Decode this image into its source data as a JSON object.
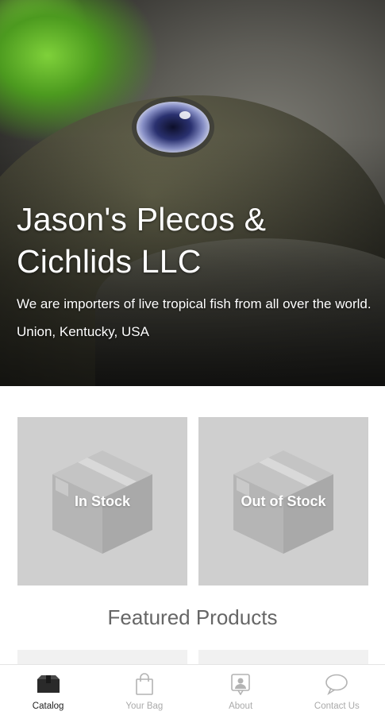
{
  "hero": {
    "title": "Jason's Plecos & Cichlids LLC",
    "tagline": "We are importers of live tropical fish from all over the world.",
    "location": "Union, Kentucky, USA"
  },
  "categories": [
    {
      "label": "In Stock",
      "icon": "box-icon"
    },
    {
      "label": "Out of Stock",
      "icon": "box-icon"
    }
  ],
  "featured": {
    "heading": "Featured Products"
  },
  "tabbar": {
    "tabs": [
      {
        "label": "Catalog",
        "icon": "catalog-icon",
        "active": true
      },
      {
        "label": "Your Bag",
        "icon": "bag-icon",
        "active": false
      },
      {
        "label": "About",
        "icon": "about-icon",
        "active": false
      },
      {
        "label": "Contact Us",
        "icon": "chat-icon",
        "active": false
      }
    ]
  },
  "colors": {
    "tile": "#cfcfcf",
    "active_tab": "#222222",
    "inactive_tab": "#aaaaaa"
  }
}
